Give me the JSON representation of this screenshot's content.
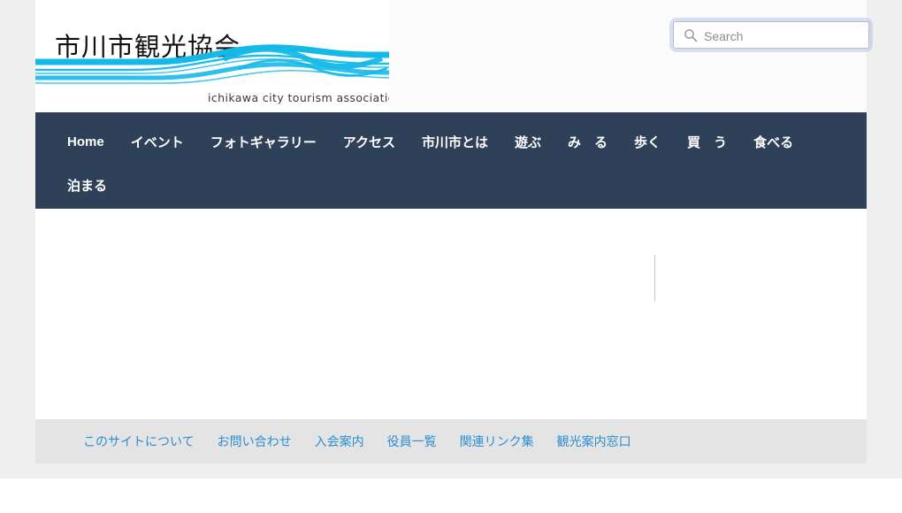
{
  "site": {
    "logo_title": "市川市観光協会",
    "logo_subtitle": "ichikawa city tourism association",
    "logo_wave_color": "#15b9e8"
  },
  "search": {
    "icon": "search-icon",
    "placeholder": "Search",
    "value": ""
  },
  "nav": {
    "background": "#2e4158",
    "text_color": "#ffffff",
    "row1": [
      {
        "label": "Home",
        "latin": true
      },
      {
        "label": "イベント",
        "latin": false
      },
      {
        "label": "フォトギャラリー",
        "latin": false
      },
      {
        "label": "アクセス",
        "latin": false
      },
      {
        "label": "市川市とは",
        "latin": false
      },
      {
        "label": "遊ぶ",
        "latin": false
      },
      {
        "label": "み　る",
        "latin": false
      },
      {
        "label": "歩く",
        "latin": false
      },
      {
        "label": "買　う",
        "latin": false
      },
      {
        "label": "食べる",
        "latin": false
      }
    ],
    "row2": [
      {
        "label": "泊まる",
        "latin": false
      }
    ]
  },
  "main": {
    "content": ""
  },
  "footer": {
    "link_color": "#2b8ed0",
    "background": "#e4e4e4",
    "links": [
      {
        "label": "このサイトについて"
      },
      {
        "label": "お問い合わせ"
      },
      {
        "label": "入会案内"
      },
      {
        "label": "役員一覧"
      },
      {
        "label": "関連リンク集"
      },
      {
        "label": "観光案内窓口"
      }
    ]
  }
}
